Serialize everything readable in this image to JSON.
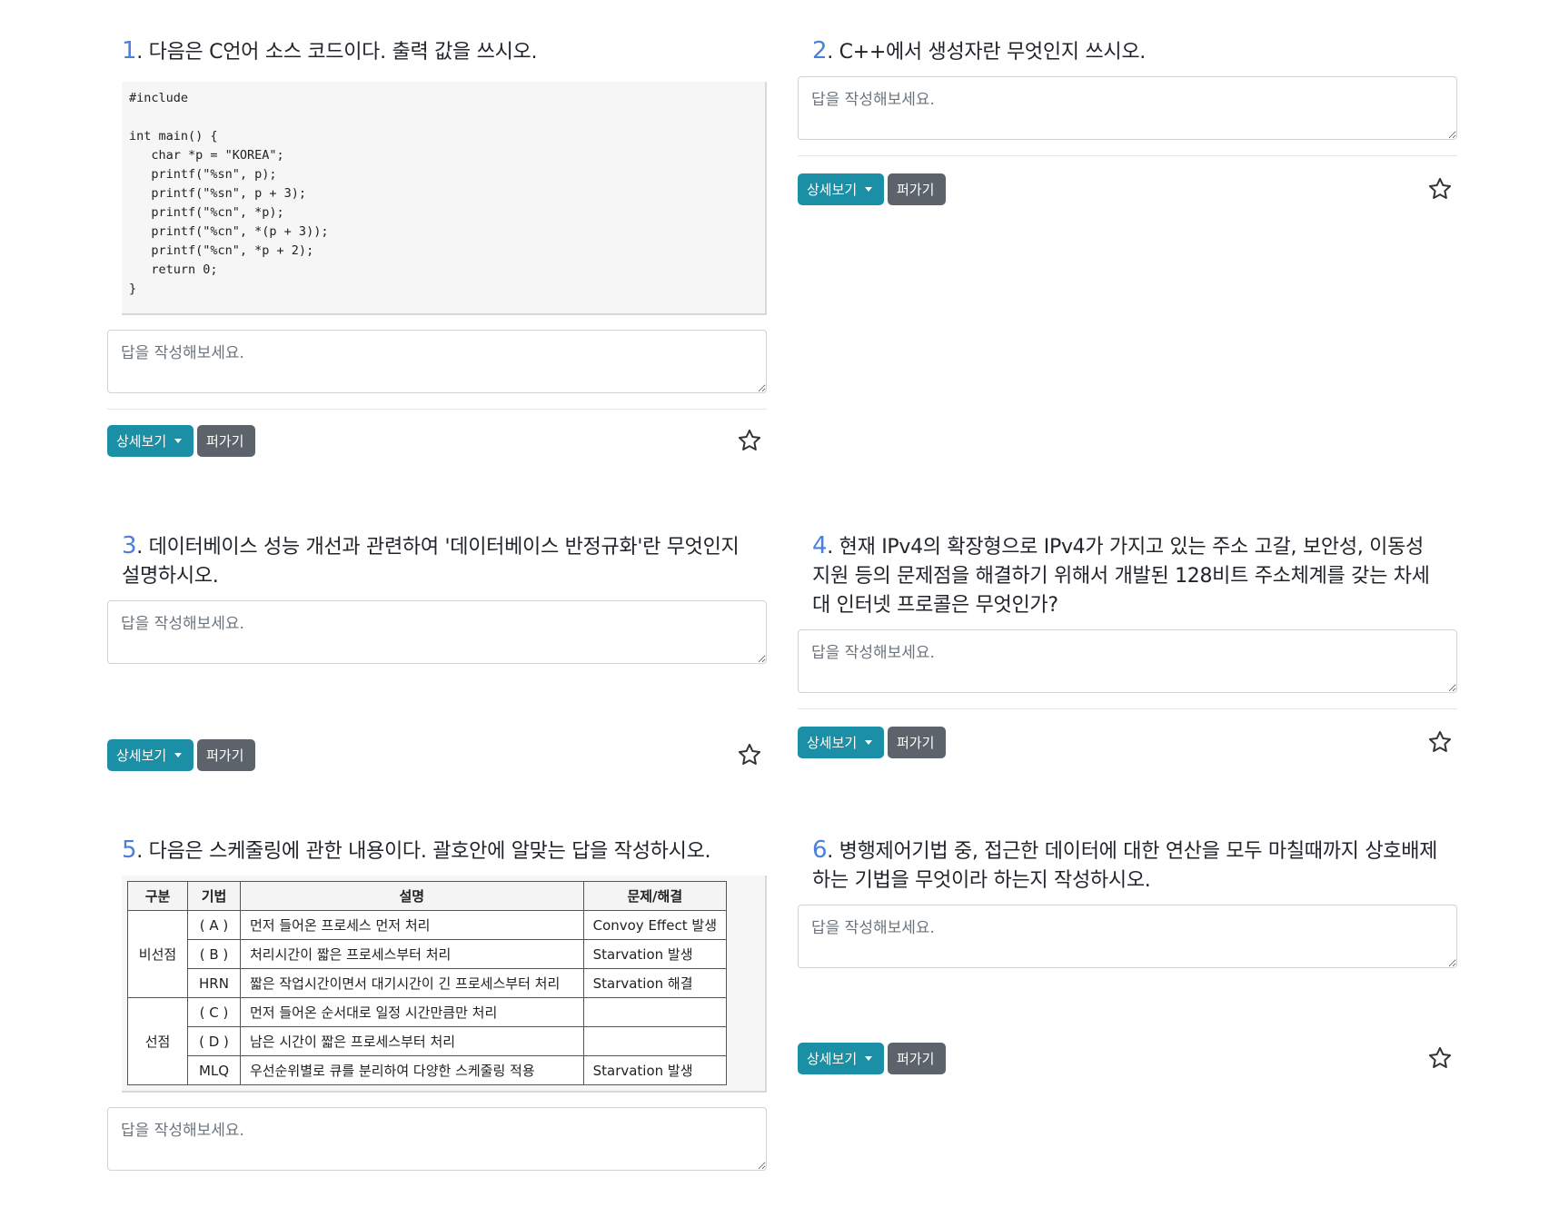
{
  "common": {
    "answer_placeholder": "답을 작성해보세요.",
    "detail_label": "상세보기",
    "share_label": "퍼가기"
  },
  "questions": [
    {
      "num": "1",
      "text": ". 다음은 C언어 소스 코드이다. 출력 값을 쓰시오.",
      "code": "#include\n\nint main() {\n   char *p = \"KOREA\";\n   printf(\"%sn\", p);\n   printf(\"%sn\", p + 3);\n   printf(\"%cn\", *p);\n   printf(\"%cn\", *(p + 3));\n   printf(\"%cn\", *p + 2);\n   return 0;\n}"
    },
    {
      "num": "2",
      "text": ". C++에서 생성자란 무엇인지 쓰시오."
    },
    {
      "num": "3",
      "text": ". 데이터베이스 성능 개선과 관련하여 '데이터베이스 반정규화'란 무엇인지 설명하시오."
    },
    {
      "num": "4",
      "text": ". 현재 IPv4의 확장형으로 IPv4가 가지고 있는 주소 고갈, 보안성, 이동성 지원 등의 문제점을 해결하기 위해서 개발된 128비트 주소체계를 갖는 차세대 인터넷 프로콜은 무엇인가?"
    },
    {
      "num": "5",
      "text": ". 다음은 스케줄링에 관한 내용이다. 괄호안에 알맞는 답을 작성하시오.",
      "table": {
        "headers": [
          "구분",
          "기법",
          "설명",
          "문제/해결"
        ],
        "groups": [
          {
            "label": "비선점",
            "rows": [
              {
                "method": "( A )",
                "desc": "먼저 들어온 프로세스 먼저 처리",
                "issue": "Convoy Effect 발생"
              },
              {
                "method": "( B )",
                "desc": "처리시간이 짧은 프로세스부터 처리",
                "issue": "Starvation 발생"
              },
              {
                "method": "HRN",
                "desc": "짧은 작업시간이면서 대기시간이 긴 프로세스부터 처리",
                "issue": "Starvation 해결"
              }
            ]
          },
          {
            "label": "선점",
            "rows": [
              {
                "method": "( C )",
                "desc": "먼저 들어온 순서대로 일정 시간만큼만 처리",
                "issue": ""
              },
              {
                "method": "( D )",
                "desc": "남은 시간이 짧은 프로세스부터 처리",
                "issue": ""
              },
              {
                "method": "MLQ",
                "desc": "우선순위별로 큐를 분리하여 다양한 스케줄링 적용",
                "issue": "Starvation 발생"
              }
            ]
          }
        ]
      }
    },
    {
      "num": "6",
      "text": ". 병행제어기법 중, 접근한 데이터에 대한 연산을 모두 마칠때까지 상호배제하는 기법을 무엇이라 하는지 작성하시오."
    }
  ]
}
